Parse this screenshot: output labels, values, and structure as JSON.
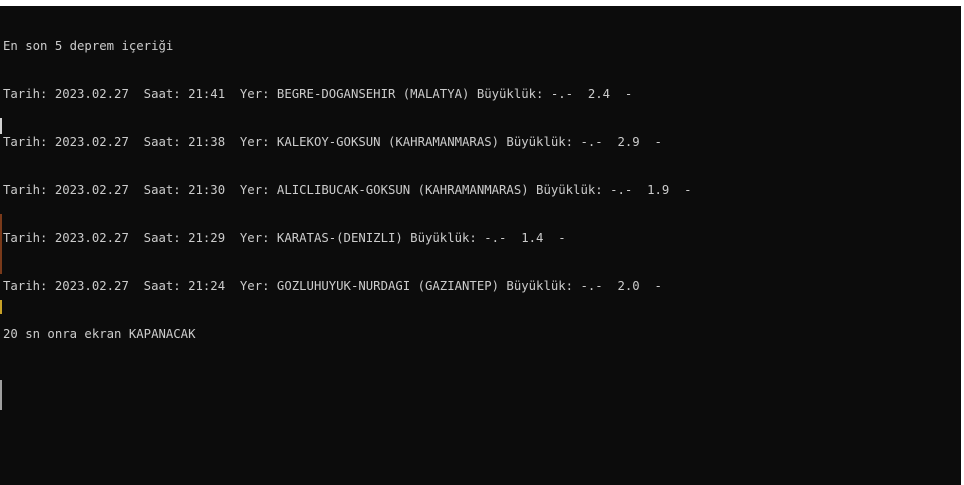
{
  "console": {
    "header": "En son 5 deprem içeriği",
    "entries": [
      "Tarih: 2023.02.27  Saat: 21:41  Yer: BEGRE-DOGANSEHIR (MALATYA) Büyüklük: -.-  2.4  -",
      "Tarih: 2023.02.27  Saat: 21:38  Yer: KALEKOY-GOKSUN (KAHRAMANMARAS) Büyüklük: -.-  2.9  -",
      "Tarih: 2023.02.27  Saat: 21:30  Yer: ALICLIBUCAK-GOKSUN (KAHRAMANMARAS) Büyüklük: -.-  1.9  -",
      "Tarih: 2023.02.27  Saat: 21:29  Yer: KARATAS-(DENIZLI) Büyüklük: -.-  1.4  -",
      "Tarih: 2023.02.27  Saat: 21:24  Yer: GOZLUHUYUK-NURDAGI (GAZIANTEP) Büyüklük: -.-  2.0  -"
    ],
    "footer": "20 sn onra ekran KAPANACAK"
  },
  "colors": {
    "background": "#0c0c0c",
    "text": "#cccccc"
  }
}
